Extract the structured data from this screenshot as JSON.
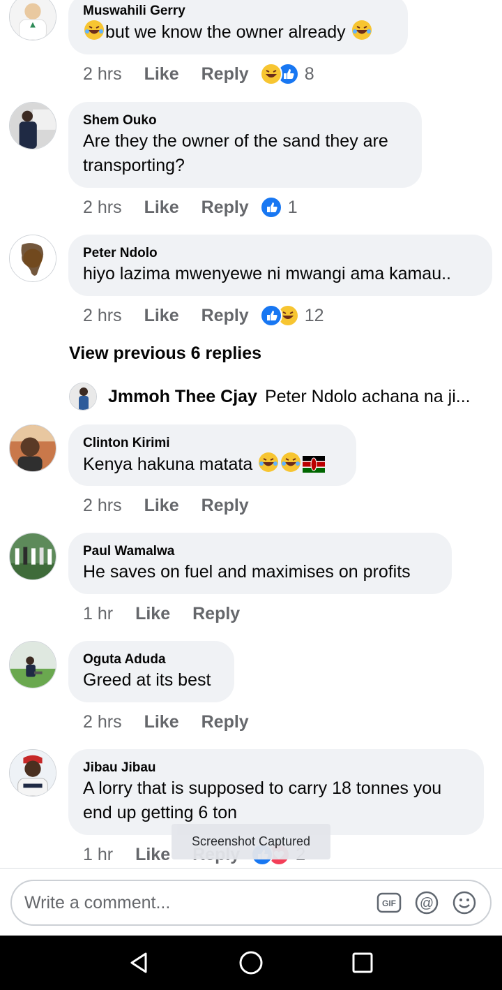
{
  "comments": [
    {
      "author": "Muswahili Gerry",
      "text": "but we know the owner already",
      "time": "2 hrs",
      "like": "Like",
      "reply": "Reply",
      "reaction_count": "8"
    },
    {
      "author": "Shem Ouko",
      "text_line1": "Are they the owner of the sand they are",
      "text_line2": "transporting?",
      "time": "2 hrs",
      "like": "Like",
      "reply": "Reply",
      "reaction_count": "1"
    },
    {
      "author": "Peter Ndolo",
      "text": "hiyo lazima mwenyewe ni mwangi ama kamau..",
      "time": "2 hrs",
      "like": "Like",
      "reply": "Reply",
      "reaction_count": "12"
    },
    {
      "author": "Clinton Kirimi",
      "text": "Kenya hakuna matata",
      "time": "2 hrs",
      "like": "Like",
      "reply": "Reply"
    },
    {
      "author": "Paul Wamalwa",
      "text": "He saves on fuel and maximises on profits",
      "time": "1 hr",
      "like": "Like",
      "reply": "Reply"
    },
    {
      "author": "Oguta Aduda",
      "text": "Greed at its best",
      "time": "2 hrs",
      "like": "Like",
      "reply": "Reply"
    },
    {
      "author": "Jibau Jibau",
      "text_line1": "A lorry that is supposed to carry 18 tonnes you",
      "text_line2": "end up getting 6 ton",
      "time": "1 hr",
      "like": "Like",
      "reply": "Reply",
      "reaction_count": "2"
    }
  ],
  "view_previous": "View previous 6 replies",
  "reply_preview": {
    "name": "Jmmoh Thee Cjay",
    "snippet": "Peter Ndolo achana na ji..."
  },
  "toast": "Screenshot Captured",
  "composer": {
    "placeholder": "Write a comment..."
  },
  "colors": {
    "like_blue": "#1877f2",
    "bubble": "#f0f2f5",
    "muted": "#65676b"
  },
  "icons": [
    "gif-icon",
    "mention-icon",
    "emoji-icon",
    "back-icon",
    "home-icon",
    "recents-icon"
  ]
}
